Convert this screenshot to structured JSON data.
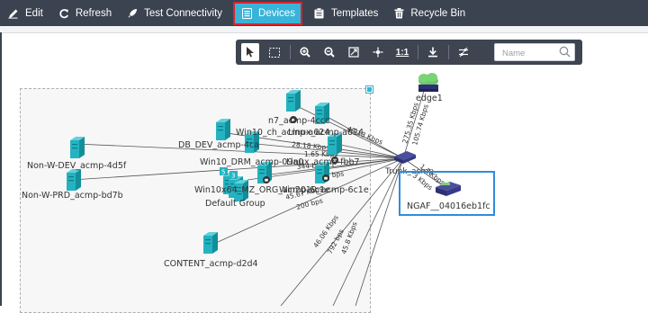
{
  "toolbar": {
    "items": [
      {
        "label": "Edit",
        "icon": "pencil-icon"
      },
      {
        "label": "Refresh",
        "icon": "refresh-icon"
      },
      {
        "label": "Test Connectivity",
        "icon": "rocket-icon"
      },
      {
        "label": "Devices",
        "icon": "devices-icon",
        "active": true
      },
      {
        "label": "Templates",
        "icon": "clipboard-icon"
      },
      {
        "label": "Recycle Bin",
        "icon": "trash-icon"
      }
    ],
    "active_color": "#39b4d8",
    "highlight_border": "#d9232f"
  },
  "map_tools": {
    "tools": [
      "pointer-icon",
      "select-box-icon",
      "zoom-in-icon",
      "zoom-out-icon",
      "fit-screen-icon",
      "layout-icon",
      "actual-size-icon",
      "download-icon",
      "filter-icon"
    ],
    "actual_size_label": "1:1",
    "search_placeholder": "Name"
  },
  "topology": {
    "group_name": "Default Group",
    "nodes": {
      "non_w_dev": "Non-W-DEV_acmp-4d5f",
      "non_w_prd": "Non-W-PRD_acmp-bd7b",
      "content": "CONTENT_acmp-d2d4",
      "db_dev": "DB_DEV_acmp-4ca",
      "vm_a": "n7_acmp-4ccc",
      "vm_b": "Win10_ch_acmp-a624",
      "vm_c": "Linux_acmp-a624",
      "vm_d": "Win10_DRM_acmp-09a0",
      "vm_e": "Linux_acmp-fbb7",
      "vm_f": "Win10x64_MZ_ORG_acmp-6c1e",
      "vm_g": "Win2019_acmp-6c1e",
      "trunk": "Trunk_acmp",
      "edge": "edge1",
      "ngaf": "NGAF__04016eb1fc"
    },
    "link_speeds": [
      "40.13 Kbps",
      "28.18 Kbps",
      "1.65 Kbps",
      "74.0 bps",
      "344 bps",
      "45.67 Kbps",
      "200 bps",
      "46.06 Kbps",
      "792 bps",
      "45.8 Kbps",
      "275.35 Kbps",
      "105.74 Kbps",
      "1.1 Kbps",
      "3 Kbps"
    ],
    "badges": [
      "5",
      "3"
    ],
    "node_color": "#24b3c0",
    "selected_border": "#2e8ddc"
  }
}
